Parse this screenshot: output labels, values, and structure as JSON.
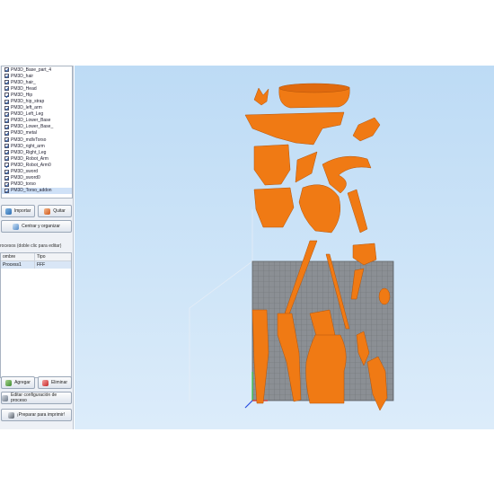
{
  "models": [
    "PM3D_Base_part_4",
    "PM3D_hair",
    "PM3D_hair_",
    "PM3D_Head",
    "PM3D_Hip",
    "PM3D_hip_strap",
    "PM3D_left_arm",
    "PM3D_Left_Leg",
    "PM3D_Lower_Base",
    "PM3D_Lower_Base_",
    "PM3D_metal",
    "PM3D_mdlvTorso",
    "PM3D_right_arm",
    "PM3D_Right_Leg",
    "PM3D_Robot_Arm",
    "PM3D_Robot_Arm0",
    "PM3D_sword",
    "PM3D_sword0",
    "PM3D_torso",
    "PM3D_Torso_addon"
  ],
  "selected_model_index": 19,
  "buttons": {
    "import": "Importar",
    "remove": "Quitar",
    "center_arrange": "Centrar y organizar",
    "add": "Agregar",
    "delete": "Eliminar",
    "edit_process": "Editar configuración de proceso",
    "prepare_print": "¡Preparar para imprimir!"
  },
  "process": {
    "label": "rocesos (doble clic para editar)",
    "columns": [
      "ombre",
      "Tipo"
    ],
    "rows": [
      {
        "name": "Process1",
        "type": "FFF"
      }
    ]
  },
  "colors": {
    "model_orange": "#f07a14",
    "viewport_sky": "#c6e0f7",
    "build_plate": "#8a8e93"
  }
}
